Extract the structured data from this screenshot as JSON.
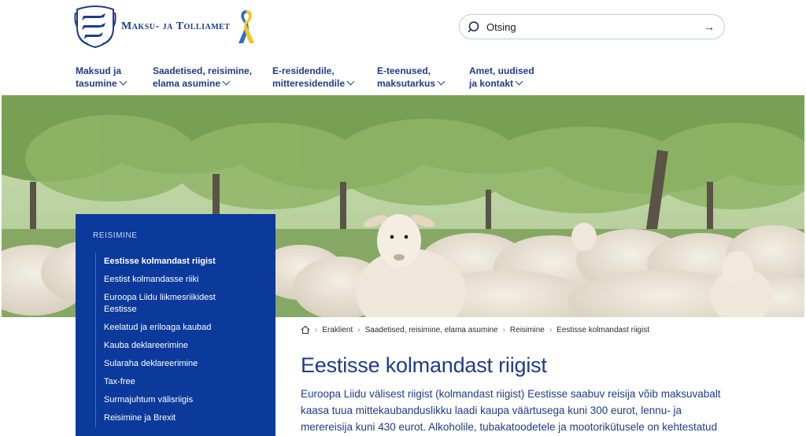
{
  "header": {
    "brand_name": "Maksu- ja Tolliamet",
    "search_placeholder": "Otsing",
    "search_value": ""
  },
  "nav": {
    "items": [
      {
        "line1": "Maksud ja",
        "line2": "tasumine"
      },
      {
        "line1": "Saadetised, reisimine,",
        "line2": "elama asumine"
      },
      {
        "line1": "E-residendile,",
        "line2": "mitteresidendile"
      },
      {
        "line1": "E-teenused,",
        "line2": "maksutarkus"
      },
      {
        "line1": "Amet, uudised",
        "line2": "ja kontakt"
      }
    ]
  },
  "sidebar": {
    "title": "REISIMINE",
    "items": [
      {
        "label": "Eestisse kolmandast riigist"
      },
      {
        "label": "Eestist kolmandasse riiki"
      },
      {
        "label": "Euroopa Liidu liikmesriikidest Eestisse"
      },
      {
        "label": "Keelatud ja eriloaga kaubad"
      },
      {
        "label": "Kauba deklareerimine"
      },
      {
        "label": "Sularaha deklareerimine"
      },
      {
        "label": "Tax-free"
      },
      {
        "label": "Surmajuhtum välisriigis"
      },
      {
        "label": "Reisimine ja Brexit"
      }
    ]
  },
  "breadcrumb": {
    "items": [
      {
        "label": "Eraklient"
      },
      {
        "label": "Saadetised, reisimine, elama asumine"
      },
      {
        "label": "Reisimine"
      },
      {
        "label": "Eestisse kolmandast riigist"
      }
    ]
  },
  "content": {
    "title": "Eestisse kolmandast riigist",
    "intro_line1": "Euroopa Liidu välisest riigist (kolmandast riigist) Eestisse saabuv reisija võib maksuvabalt",
    "intro_line2": "kaasa tuua mittekaubanduslikku laadi kaupa väärtusega kuni 300 eurot, lennu- ja",
    "intro_line3": "merereisija kuni 430 eurot. Alkoholile, tubakatoodetele ja mootorikütusele on kehtestatud"
  },
  "colors": {
    "brand_blue": "#1e3c8c",
    "sidebar_blue": "#0b3a9c",
    "ribbon_blue": "#2f6fc9",
    "ribbon_yellow": "#f5c518"
  }
}
